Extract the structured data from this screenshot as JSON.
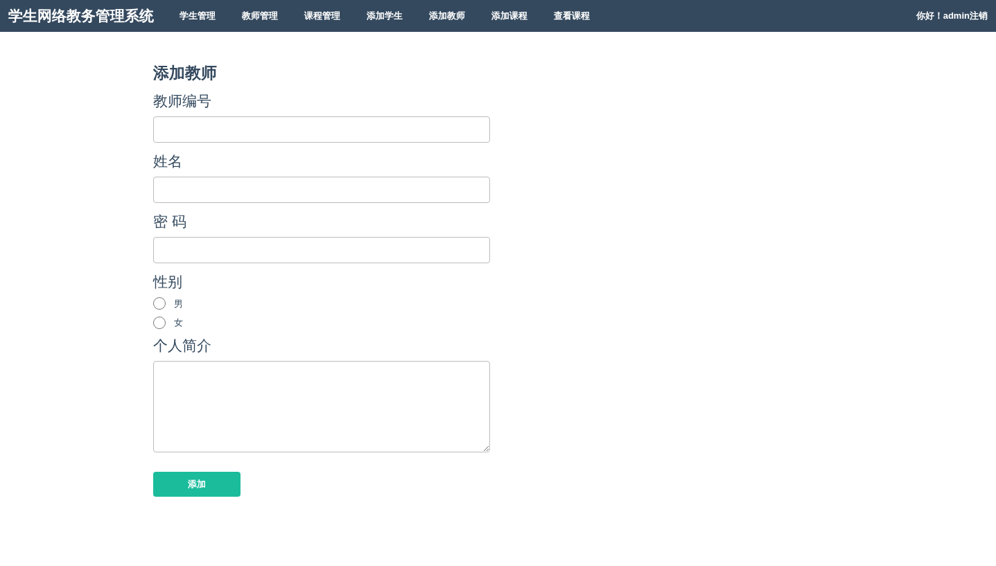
{
  "navbar": {
    "brand": "学生网络教务管理系统",
    "links": [
      {
        "label": "学生管理",
        "selected": false
      },
      {
        "label": "教师管理",
        "selected": false
      },
      {
        "label": "课程管理",
        "selected": false
      },
      {
        "label": "添加学生",
        "selected": false
      },
      {
        "label": "添加教师",
        "selected": false
      },
      {
        "label": "添加课程",
        "selected": false
      },
      {
        "label": "查看课程",
        "selected": false
      }
    ],
    "greeting": "你好！admin",
    "logout": "注销"
  },
  "form": {
    "title": "添加教师",
    "fields": [
      {
        "kind": "text",
        "label": "教师编号"
      },
      {
        "kind": "text",
        "label": "姓名"
      },
      {
        "kind": "password",
        "label": "密 码"
      },
      {
        "kind": "radio",
        "label": "性别",
        "options": [
          {
            "label": "男",
            "selected": false
          },
          {
            "label": "女",
            "selected": false
          }
        ]
      },
      {
        "kind": "textarea",
        "label": "个人简介"
      }
    ],
    "submit": "添加"
  }
}
